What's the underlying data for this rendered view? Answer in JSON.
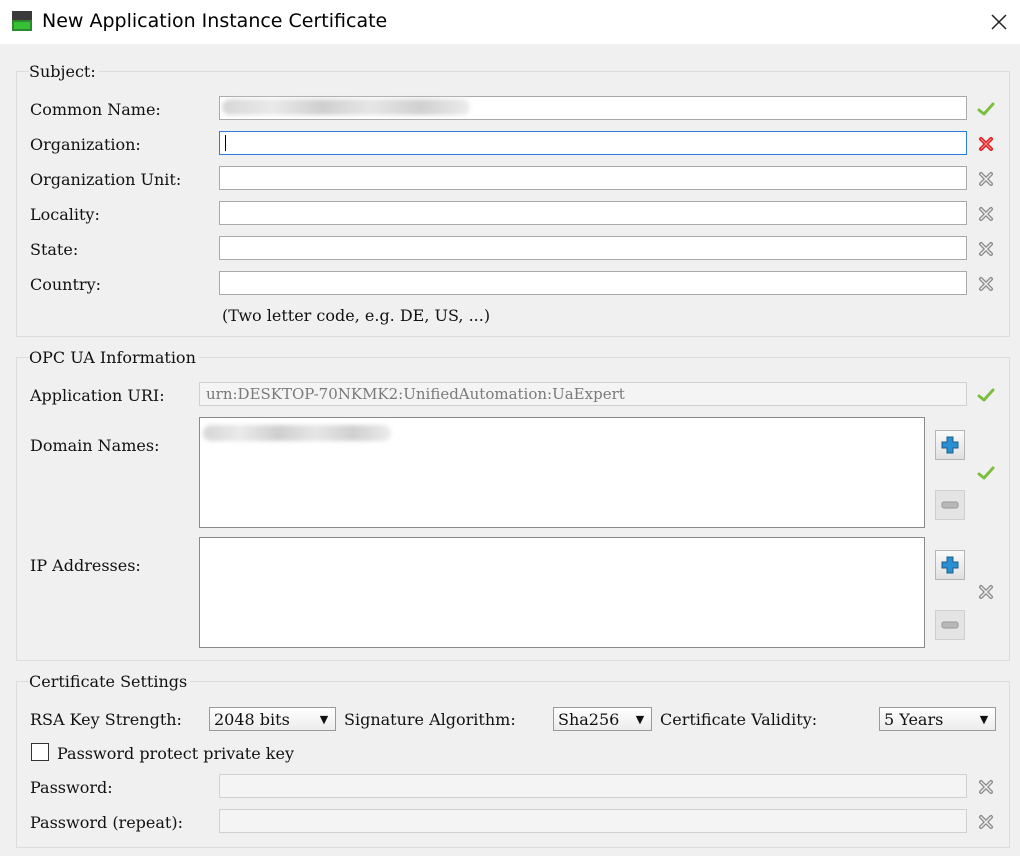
{
  "window": {
    "title": "New Application Instance Certificate"
  },
  "icons": {
    "app": "certificate-app-icon",
    "close": "close-icon",
    "ok": "green-check-icon",
    "error": "red-x-icon",
    "neutral": "gray-x-icon",
    "add": "plus-icon",
    "remove": "minus-icon"
  },
  "colors": {
    "ok": "#7cbf3f",
    "error": "#e02020",
    "neutral": "#9a9a9a",
    "focus": "#2f7bd8",
    "add": "#2a8fd0"
  },
  "subject": {
    "legend": "Subject:",
    "common_name_label": "Common Name:",
    "organization_label": "Organization:",
    "organization_unit_label": "Organization Unit:",
    "locality_label": "Locality:",
    "state_label": "State:",
    "country_label": "Country:",
    "country_hint": "(Two letter code, e.g. DE, US, ...)"
  },
  "opc": {
    "legend": "OPC UA Information",
    "app_uri_label": "Application URI:",
    "app_uri_value": "urn:DESKTOP-70NKMK2:UnifiedAutomation:UaExpert",
    "domain_names_label": "Domain Names:",
    "ip_addresses_label": "IP Addresses:"
  },
  "cert": {
    "legend": "Certificate Settings",
    "rsa_label": "RSA Key Strength:",
    "rsa_value": "2048 bits",
    "sig_label": "Signature Algorithm:",
    "sig_value": "Sha256",
    "validity_label": "Certificate Validity:",
    "validity_value": "5 Years",
    "password_protect_label": "Password protect private key",
    "password_label": "Password:",
    "password_repeat_label": "Password (repeat):"
  }
}
